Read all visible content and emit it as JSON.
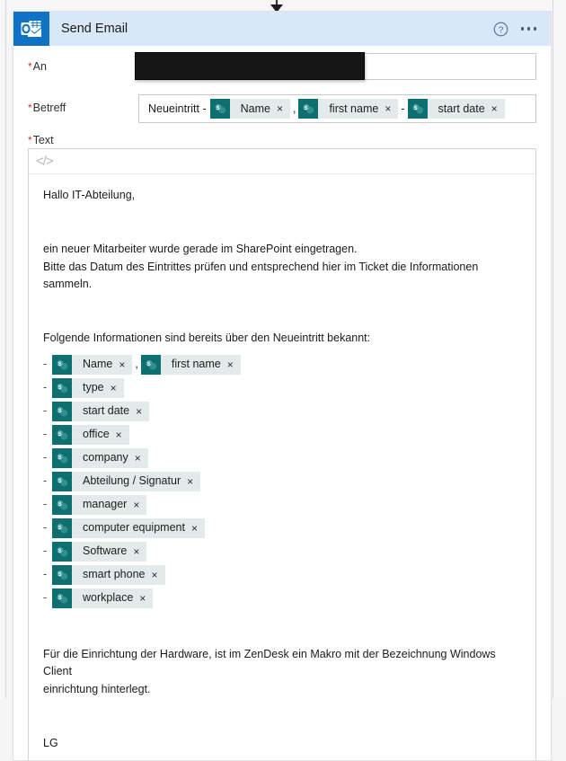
{
  "card": {
    "app_icon": "outlook-icon",
    "title": "Send Email",
    "help_icon": "help-circle-icon",
    "more_icon": "ellipsis-icon"
  },
  "fields": {
    "to": {
      "required_marker": "*",
      "label": "An",
      "value": "",
      "redacted": true
    },
    "subject": {
      "required_marker": "*",
      "label": "Betreff",
      "static_prefix": "Neueintritt -",
      "separator_comma": ",",
      "separator_dash": "-",
      "tokens": [
        {
          "label": "Name",
          "close": "×",
          "icon": "sharepoint-icon"
        },
        {
          "label": "first name",
          "close": "×",
          "icon": "sharepoint-icon"
        },
        {
          "label": "start date",
          "close": "×",
          "icon": "sharepoint-icon"
        }
      ]
    },
    "body": {
      "required_marker": "*",
      "label": "Text",
      "toolbar": {
        "code_view": "</>"
      },
      "greeting": "Hallo IT-Abteilung,",
      "para1": "ein neuer Mitarbeiter wurde gerade im SharePoint eingetragen.",
      "para2": "Bitte das Datum des Eintrittes prüfen und entsprechend hier im Ticket die Informationen sammeln.",
      "list_intro": "Folgende Informationen sind bereits über den Neueintritt bekannt:",
      "bullet": "-",
      "comma": ",",
      "list": [
        {
          "tokens": [
            {
              "label": "Name",
              "close": "×",
              "icon": "sharepoint-icon"
            },
            {
              "label": "first name",
              "close": "×",
              "icon": "sharepoint-icon"
            }
          ]
        },
        {
          "tokens": [
            {
              "label": "type",
              "close": "×",
              "icon": "sharepoint-icon"
            }
          ]
        },
        {
          "tokens": [
            {
              "label": "start date",
              "close": "×",
              "icon": "sharepoint-icon"
            }
          ]
        },
        {
          "tokens": [
            {
              "label": "office",
              "close": "×",
              "icon": "sharepoint-icon"
            }
          ]
        },
        {
          "tokens": [
            {
              "label": "company",
              "close": "×",
              "icon": "sharepoint-icon"
            }
          ]
        },
        {
          "tokens": [
            {
              "label": "Abteilung / Signatur",
              "close": "×",
              "icon": "sharepoint-icon"
            }
          ]
        },
        {
          "tokens": [
            {
              "label": "manager",
              "close": "×",
              "icon": "sharepoint-icon"
            }
          ]
        },
        {
          "tokens": [
            {
              "label": "computer equipment",
              "close": "×",
              "icon": "sharepoint-icon"
            }
          ]
        },
        {
          "tokens": [
            {
              "label": "Software",
              "close": "×",
              "icon": "sharepoint-icon"
            }
          ]
        },
        {
          "tokens": [
            {
              "label": "smart phone",
              "close": "×",
              "icon": "sharepoint-icon"
            }
          ]
        },
        {
          "tokens": [
            {
              "label": "workplace",
              "close": "×",
              "icon": "sharepoint-icon"
            }
          ]
        }
      ],
      "para3_line1": "Für die Einrichtung der Hardware, ist im ZenDesk ein Makro mit der Bezeichnung Windows Client",
      "para3_line2": "einrichtung hinterlegt.",
      "signoff": "LG"
    }
  },
  "colors": {
    "header_bg": "#d9e8f8",
    "app_icon_bg": "#0f72c4",
    "token_icon_bg": "#0d6f70",
    "token_bg": "#e3eaea",
    "required_star": "#c0392b",
    "page_bg": "#f6f6f6"
  }
}
